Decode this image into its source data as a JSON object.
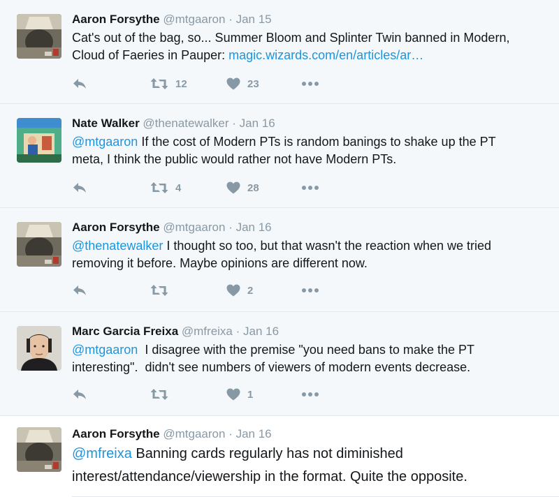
{
  "tweets": [
    {
      "fullname": "Aaron Forsythe",
      "username": "@mtgaaron",
      "separator": "·",
      "time": "Jan 15",
      "text_line1": "Cat's out of the bag, so... Summer Bloom and Splinter Twin banned in Modern,",
      "text_line2_prefix": "Cloud of Faeries in Pauper: ",
      "text_link": "magic.wizards.com/en/articles/ar…",
      "retweets": "12",
      "likes": "23"
    },
    {
      "fullname": "Nate Walker",
      "username": "@thenatewalker",
      "separator": "·",
      "time": "Jan 16",
      "mention": "@mtgaaron",
      "text_line1_rest": " If the cost of Modern PTs is random banings to shake up the PT",
      "text_line2": "meta, I think the public would rather not have Modern PTs.",
      "retweets": "4",
      "likes": "28"
    },
    {
      "fullname": "Aaron Forsythe",
      "username": "@mtgaaron",
      "separator": "·",
      "time": "Jan 16",
      "mention": "@thenatewalker",
      "text_line1_rest": " I thought so too, but that wasn't the reaction when we tried",
      "text_line2": "removing it before. Maybe opinions are different now.",
      "retweets": "",
      "likes": "2"
    },
    {
      "fullname": "Marc Garcia Freixa",
      "username": "@mfreixa",
      "separator": "·",
      "time": "Jan 16",
      "mention": "@mtgaaron",
      "text_line1_rest": "  I disagree with the premise \"you need bans to make the PT",
      "text_line2": "interesting\".  didn't see numbers of viewers of modern events decrease.",
      "retweets": "",
      "likes": "1"
    },
    {
      "fullname": "Aaron Forsythe",
      "username": "@mtgaaron",
      "separator": "·",
      "time": "Jan 16",
      "mention": "@mfreixa",
      "text_line1_rest": " Banning cards regularly has not diminished",
      "text_line2": "interest/attendance/viewership in the format. Quite the opposite."
    }
  ],
  "icons": {
    "reply": "reply-icon",
    "retweet": "retweet-icon",
    "like": "heart-icon",
    "more": "more-icon"
  },
  "colors": {
    "link": "#1b95e0",
    "muted": "#8899a6",
    "text": "#14171a",
    "background": "#f5f8fa",
    "border": "#e1e8ed"
  }
}
